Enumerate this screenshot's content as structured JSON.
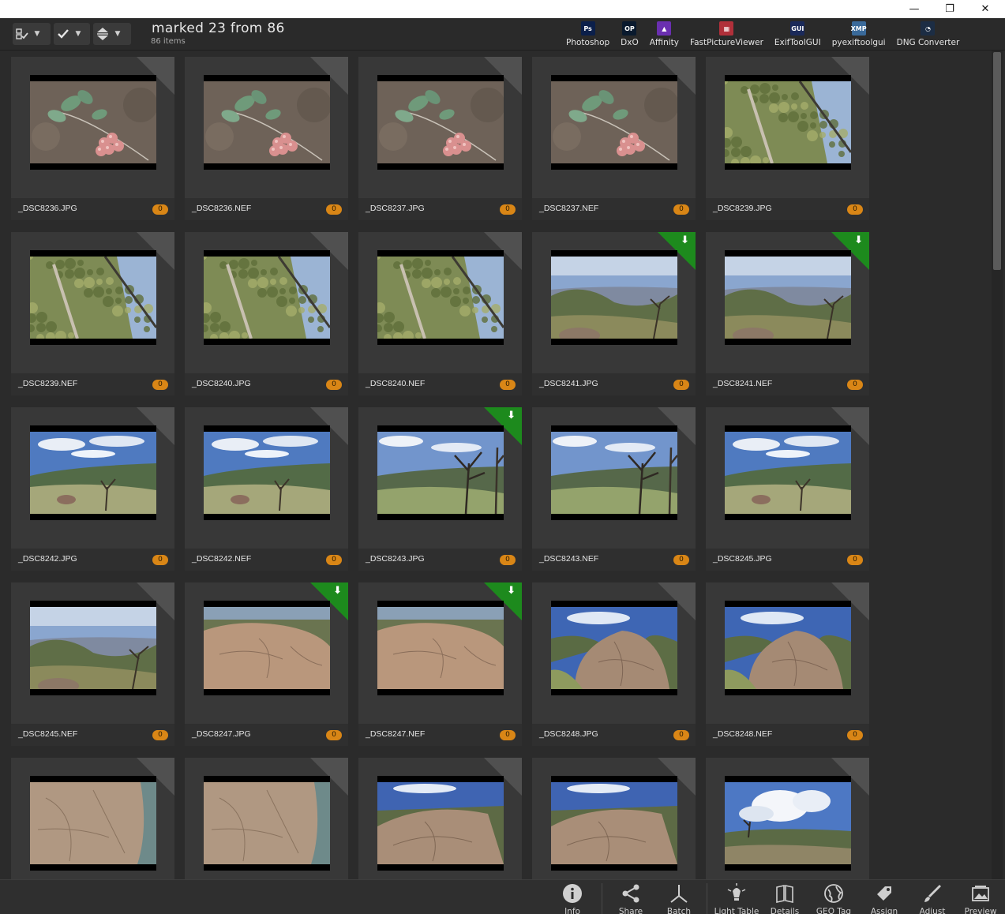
{
  "window": {
    "minimize_label": "—",
    "restore_label": "❐",
    "close_label": "✕"
  },
  "toolbar": {
    "status_title": "marked 23 from 86",
    "status_sub": "86 items",
    "apps": [
      {
        "label": "Photoshop",
        "icon": "photoshop-icon",
        "icon_text": "Ps",
        "color": "#0b1f4a"
      },
      {
        "label": "DxO",
        "icon": "dxo-icon",
        "icon_text": "OP",
        "color": "#0a1a2e"
      },
      {
        "label": "Affinity",
        "icon": "affinity-icon",
        "icon_text": "▲",
        "color": "#6a2fb0"
      },
      {
        "label": "FastPictureViewer",
        "icon": "fastpictureviewer-icon",
        "icon_text": "▦",
        "color": "#b0303a"
      },
      {
        "label": "ExifToolGUI",
        "icon": "exiftoolgui-icon",
        "icon_text": "GUI",
        "color": "#1b2a5a"
      },
      {
        "label": "pyexiftoolgui",
        "icon": "pyexiftoolgui-icon",
        "icon_text": "XMP",
        "color": "#3a6a9a"
      },
      {
        "label": "DNG Converter",
        "icon": "dng-converter-icon",
        "icon_text": "◔",
        "color": "#1c2d44"
      }
    ]
  },
  "tiles": [
    {
      "name": "_DSC8236.JPG",
      "badge": "0",
      "marked": false,
      "scene": "berries"
    },
    {
      "name": "_DSC8236.NEF",
      "badge": "0",
      "marked": false,
      "scene": "berries"
    },
    {
      "name": "_DSC8237.JPG",
      "badge": "0",
      "marked": false,
      "scene": "berries"
    },
    {
      "name": "_DSC8237.NEF",
      "badge": "0",
      "marked": false,
      "scene": "berries"
    },
    {
      "name": "_DSC8239.JPG",
      "badge": "0",
      "marked": false,
      "scene": "tree"
    },
    {
      "name": "_DSC8239.NEF",
      "badge": "0",
      "marked": false,
      "scene": "tree"
    },
    {
      "name": "_DSC8240.JPG",
      "badge": "0",
      "marked": false,
      "scene": "tree"
    },
    {
      "name": "_DSC8240.NEF",
      "badge": "0",
      "marked": false,
      "scene": "tree"
    },
    {
      "name": "_DSC8241.JPG",
      "badge": "0",
      "marked": true,
      "scene": "valley"
    },
    {
      "name": "_DSC8241.NEF",
      "badge": "0",
      "marked": true,
      "scene": "valley"
    },
    {
      "name": "_DSC8242.JPG",
      "badge": "0",
      "marked": false,
      "scene": "hills"
    },
    {
      "name": "_DSC8242.NEF",
      "badge": "0",
      "marked": false,
      "scene": "hills"
    },
    {
      "name": "_DSC8243.JPG",
      "badge": "0",
      "marked": true,
      "scene": "deadtree"
    },
    {
      "name": "_DSC8243.NEF",
      "badge": "0",
      "marked": false,
      "scene": "deadtree"
    },
    {
      "name": "_DSC8245.JPG",
      "badge": "0",
      "marked": false,
      "scene": "hills"
    },
    {
      "name": "_DSC8245.NEF",
      "badge": "0",
      "marked": false,
      "scene": "valley"
    },
    {
      "name": "_DSC8247.JPG",
      "badge": "0",
      "marked": true,
      "scene": "rock"
    },
    {
      "name": "_DSC8247.NEF",
      "badge": "0",
      "marked": true,
      "scene": "rock"
    },
    {
      "name": "_DSC8248.JPG",
      "badge": "0",
      "marked": false,
      "scene": "boulder"
    },
    {
      "name": "_DSC8248.NEF",
      "badge": "0",
      "marked": false,
      "scene": "boulder"
    },
    {
      "name": "",
      "badge": "",
      "marked": false,
      "scene": "rockcloseup"
    },
    {
      "name": "",
      "badge": "",
      "marked": false,
      "scene": "rockcloseup"
    },
    {
      "name": "",
      "badge": "",
      "marked": false,
      "scene": "rockflat"
    },
    {
      "name": "",
      "badge": "",
      "marked": false,
      "scene": "rockflat"
    },
    {
      "name": "",
      "badge": "",
      "marked": false,
      "scene": "clouds"
    }
  ],
  "bottombar": {
    "buttons": [
      {
        "label": "Info",
        "icon": "info-icon"
      },
      {
        "label": "Share",
        "icon": "share-icon"
      },
      {
        "label": "Batch",
        "icon": "batch-icon"
      },
      {
        "label": "Light Table",
        "icon": "light-table-icon"
      },
      {
        "label": "Details",
        "icon": "details-icon"
      },
      {
        "label": "GEO Tag",
        "icon": "geo-tag-icon"
      },
      {
        "label": "Assign",
        "icon": "assign-icon"
      },
      {
        "label": "Adjust",
        "icon": "adjust-icon"
      },
      {
        "label": "Preview",
        "icon": "preview-icon"
      }
    ]
  }
}
